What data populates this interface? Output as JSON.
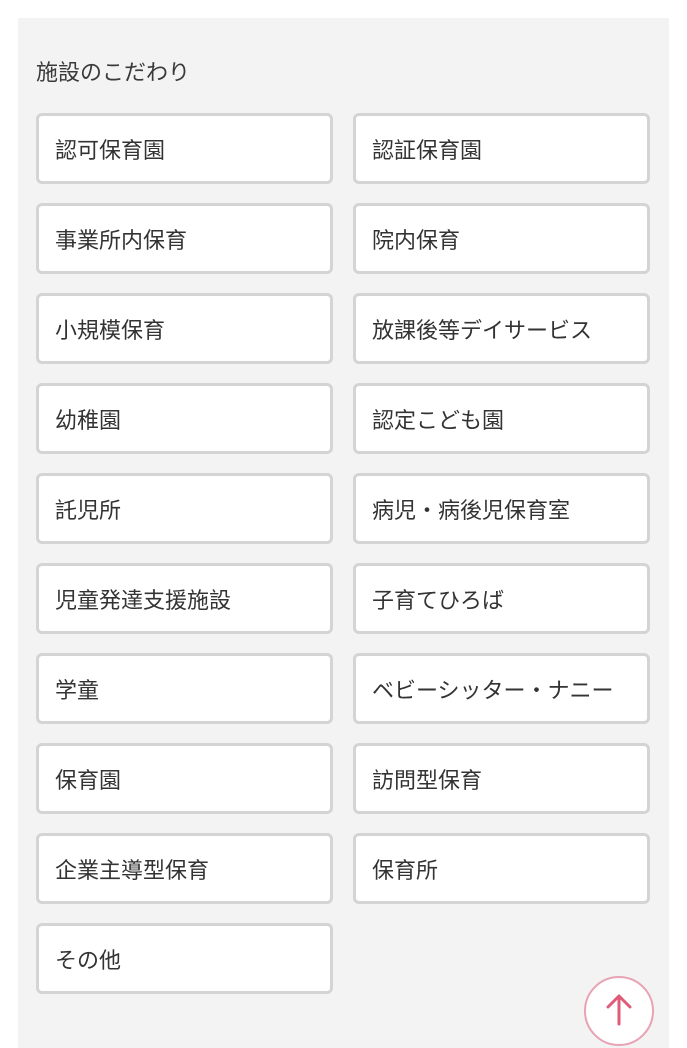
{
  "section": {
    "title": "施設のこだわり"
  },
  "facility_options": [
    "認可保育園",
    "認証保育園",
    "事業所内保育",
    "院内保育",
    "小規模保育",
    "放課後等デイサービス",
    "幼稚園",
    "認定こども園",
    "託児所",
    "病児・病後児保育室",
    "児童発達支援施設",
    "子育てひろば",
    "学童",
    "ベビーシッター・ナニー",
    "保育園",
    "訪問型保育",
    "企業主導型保育",
    "保育所",
    "その他"
  ],
  "scroll_top": {
    "icon": "arrow-up-icon",
    "accent_color": "#e05a7a"
  }
}
